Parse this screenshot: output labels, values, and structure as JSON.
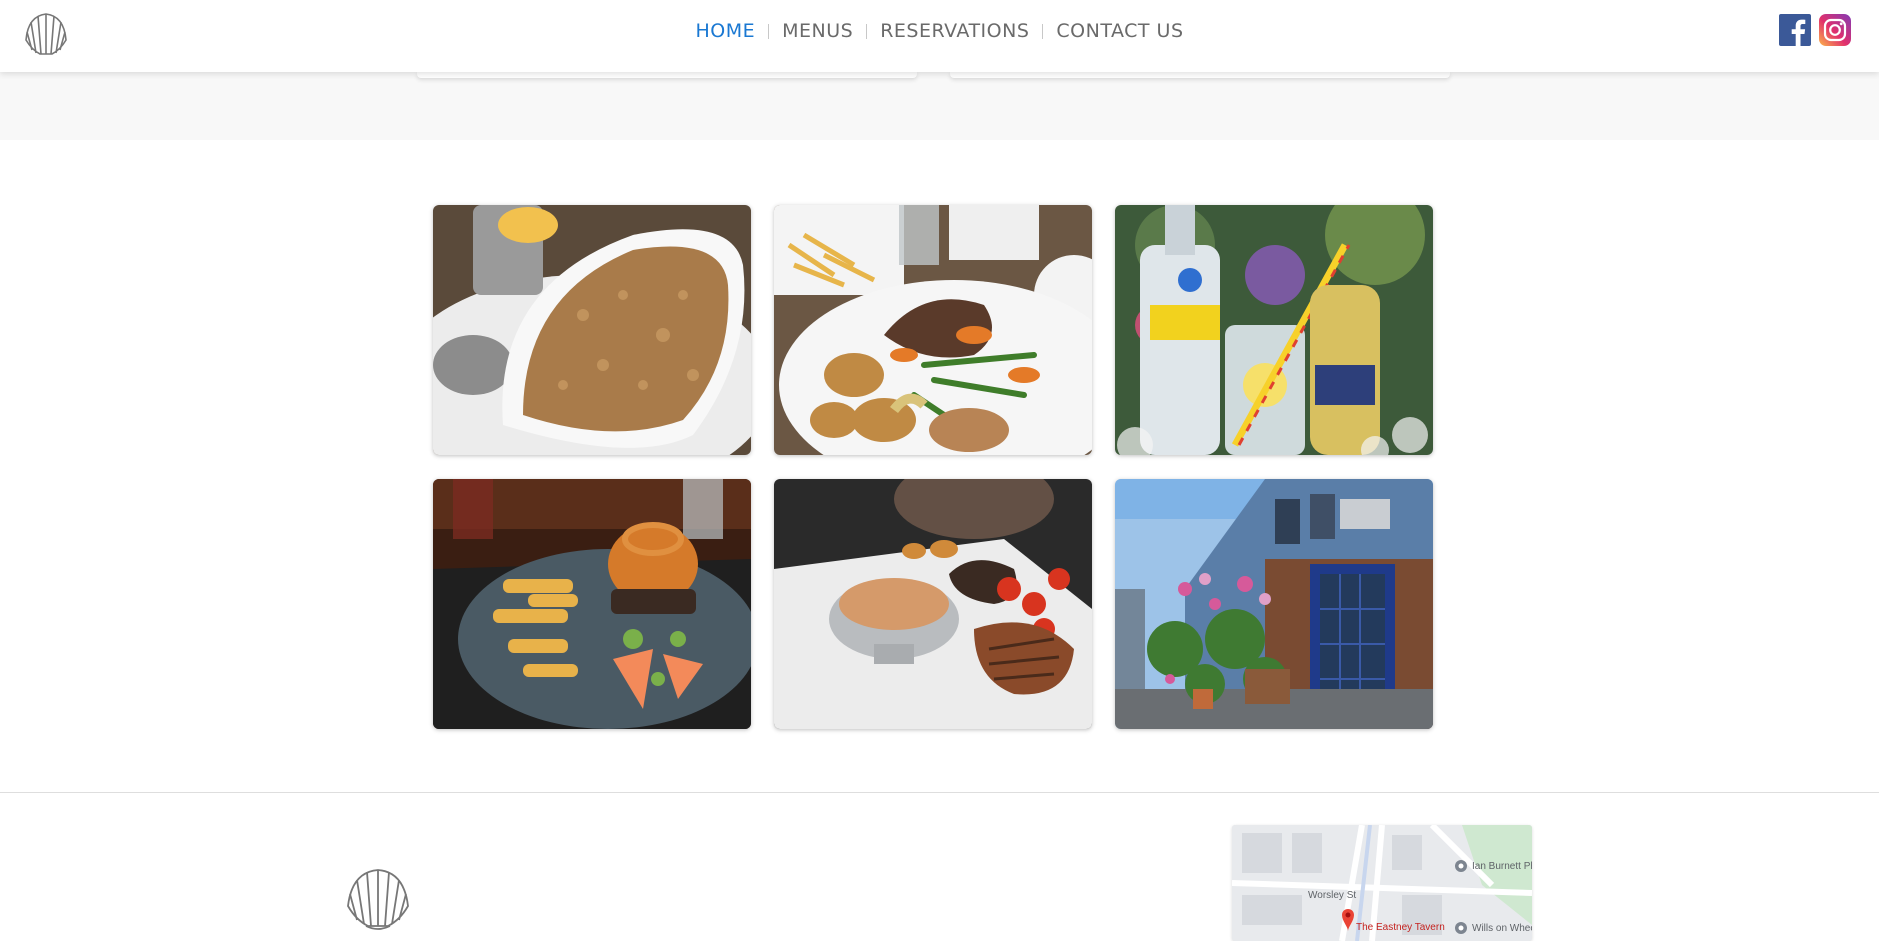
{
  "header": {
    "logo_icon": "scallop-shell-icon",
    "nav": [
      {
        "label": "HOME",
        "active": true
      },
      {
        "label": "MENUS",
        "active": false
      },
      {
        "label": "RESERVATIONS",
        "active": false
      },
      {
        "label": "CONTACT US",
        "active": false
      }
    ],
    "social": [
      "facebook-icon",
      "instagram-icon"
    ],
    "accent_color": "#1a78d2"
  },
  "gallery": {
    "photos": [
      "fruit-crumble-photo",
      "roast-dinner-photo",
      "vodka-lemonade-photo",
      "burger-and-chips-photo",
      "steak-with-sauce-photo",
      "tavern-entrance-photo"
    ]
  },
  "footer": {
    "logo_icon": "scallop-shell-icon",
    "map": {
      "street_label": "Worsley St",
      "pin_label": "The Eastney Tavern",
      "place_1": "Ian Burnett Ph",
      "place_2": "Wills on Whee"
    }
  }
}
